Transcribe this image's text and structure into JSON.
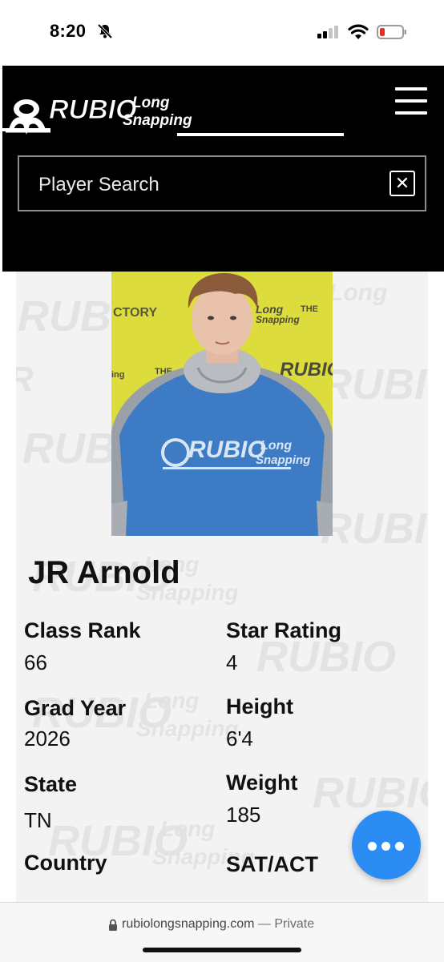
{
  "status_bar": {
    "time": "8:20"
  },
  "site": {
    "logo_word": "RUBIO",
    "logo_line1": "Long",
    "logo_line2": "Snapping",
    "search": {
      "placeholder": "Player Search",
      "clear_icon": "close-icon"
    },
    "menu_icon": "hamburger-icon"
  },
  "player": {
    "name": "JR Arnold",
    "shirt_word": "RUBIO",
    "shirt_line1": "Long",
    "shirt_line2": "Snapping",
    "backdrop_text": "CTORY",
    "stats": {
      "class_rank_label": "Class Rank",
      "class_rank": "66",
      "star_rating_label": "Star Rating",
      "star_rating": "4",
      "grad_year_label": "Grad Year",
      "grad_year": "2026",
      "height_label": "Height",
      "height": "6'4",
      "state_label": "State",
      "state": "TN",
      "weight_label": "Weight",
      "weight": "185",
      "country_label": "Country",
      "sat_act_label": "SAT/ACT"
    }
  },
  "browser": {
    "url": "rubiolongsnapping.com",
    "privacy": " — Private"
  },
  "colors": {
    "header_bg": "#000000",
    "fab": "#2b8df4",
    "photo_backdrop": "#dcdc3c",
    "shirt": "#3d7bc4"
  }
}
